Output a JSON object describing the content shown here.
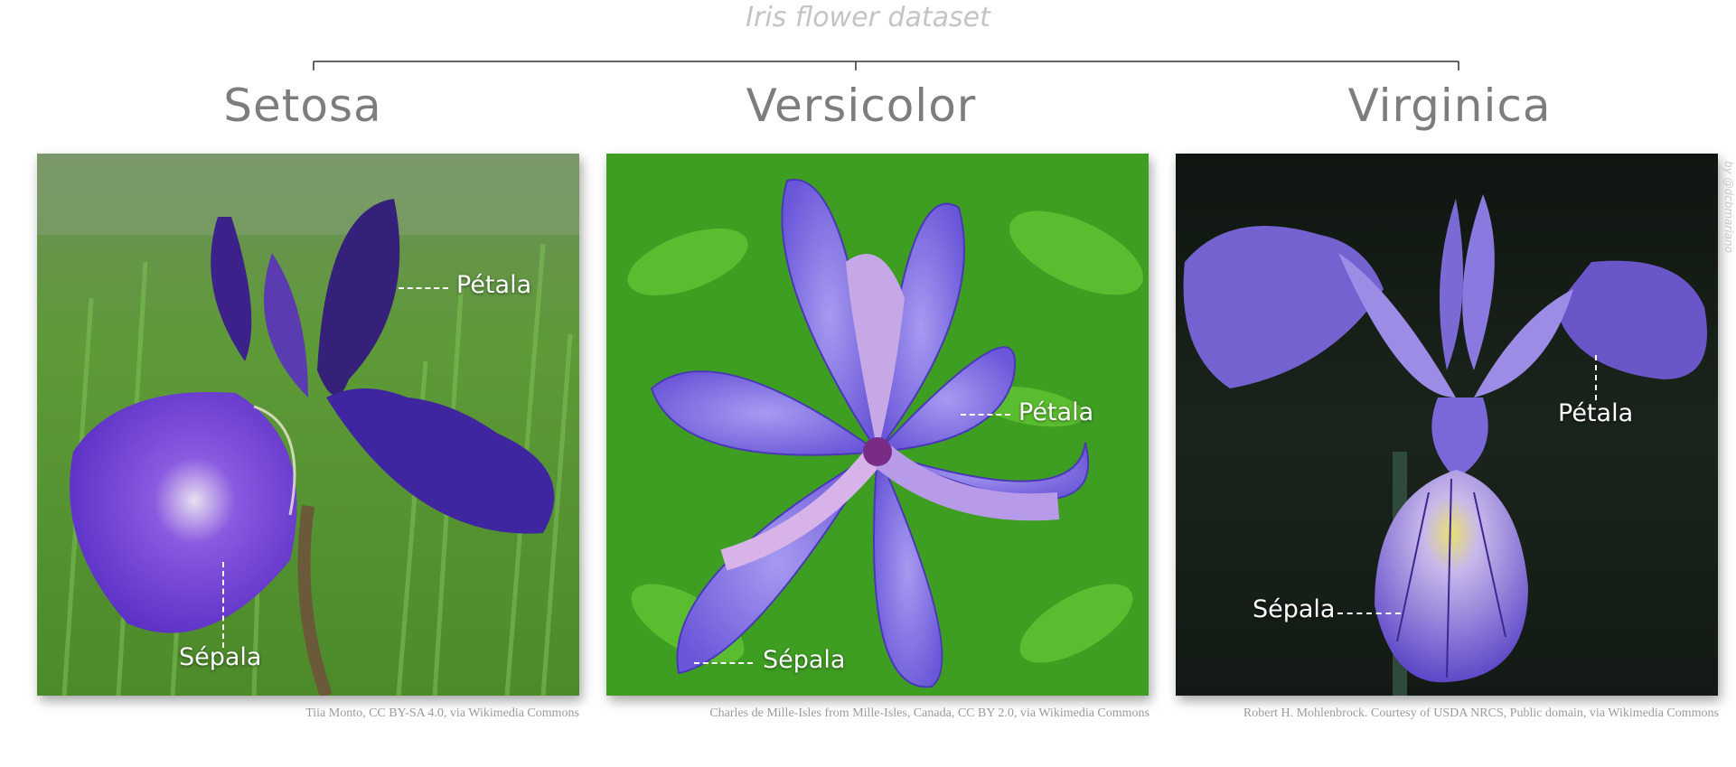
{
  "title": "Iris flower dataset",
  "species": [
    {
      "name": "Setosa",
      "petal_label": "Pétala",
      "sepal_label": "Sépala",
      "credit": "Tiia Monto, CC BY-SA 4.0, via Wikimedia Commons"
    },
    {
      "name": "Versicolor",
      "petal_label": "Pétala",
      "sepal_label": "Sépala",
      "credit": "Charles de Mille-Isles from Mille-Isles, Canada, CC BY 2.0, via Wikimedia Commons"
    },
    {
      "name": "Virginica",
      "petal_label": "Pétala",
      "sepal_label": "Sépala",
      "credit": "Robert H. Mohlenbrock. Courtesy of USDA NRCS, Public domain, via Wikimedia Commons"
    }
  ],
  "watermark": "by @dcbmariano",
  "colors": {
    "title": "#c4c4c4",
    "species": "#7d7d7d",
    "petal": "#6a4fd0",
    "setosa_bg": "#5f9a3a",
    "versicolor_bg": "#3e9e22",
    "virginica_bg": "#121a14"
  }
}
